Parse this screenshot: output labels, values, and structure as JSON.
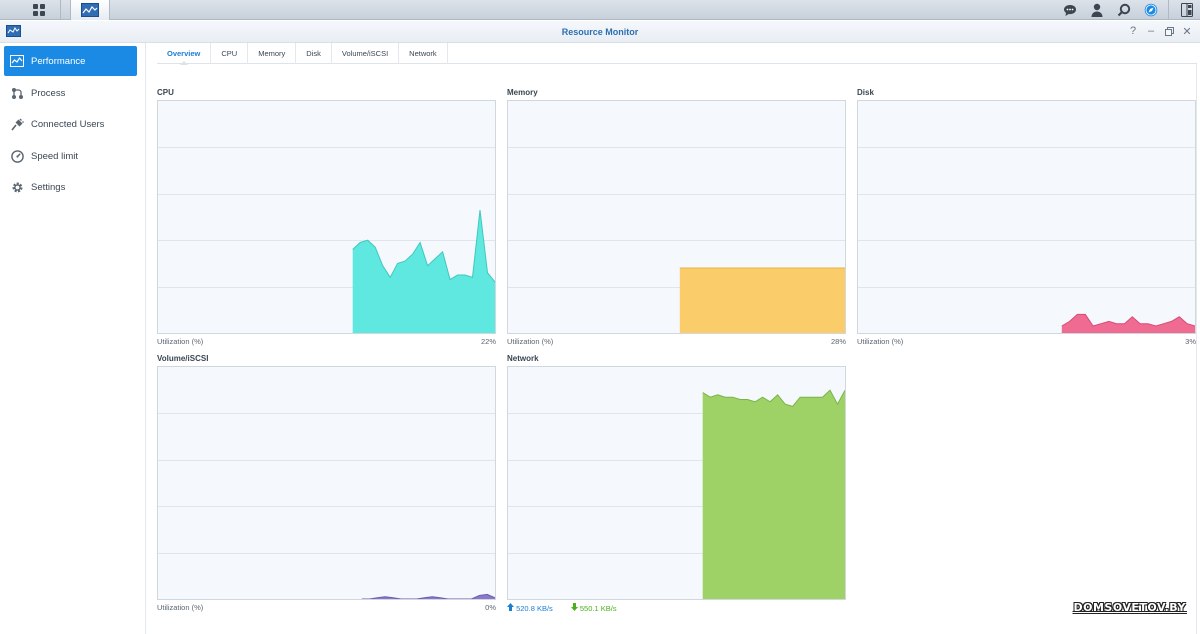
{
  "window": {
    "title": "Resource Monitor"
  },
  "taskbar": {
    "right_icons": [
      "chat-icon",
      "user-icon",
      "search-icon",
      "compass-icon",
      "widgets-icon"
    ]
  },
  "sidebar": {
    "items": [
      {
        "label": "Performance",
        "icon": "performance-icon",
        "active": true
      },
      {
        "label": "Process",
        "icon": "process-icon"
      },
      {
        "label": "Connected Users",
        "icon": "plug-icon"
      },
      {
        "label": "Speed limit",
        "icon": "speedometer-icon"
      },
      {
        "label": "Settings",
        "icon": "gear-icon"
      }
    ]
  },
  "tabs": [
    "Overview",
    "CPU",
    "Memory",
    "Disk",
    "Volume/iSCSI",
    "Network"
  ],
  "panels": {
    "cpu": {
      "title": "CPU",
      "foot_label": "Utilization (%)",
      "foot_value": "22%",
      "color": "#5ee8e0",
      "stroke": "#3fc7c0"
    },
    "memory": {
      "title": "Memory",
      "foot_label": "Utilization (%)",
      "foot_value": "28%",
      "color": "#fbcd6a",
      "stroke": "#e8b447"
    },
    "disk": {
      "title": "Disk",
      "foot_label": "Utilization (%)",
      "foot_value": "3%",
      "color": "#f06b92",
      "stroke": "#d94a76"
    },
    "volume": {
      "title": "Volume/iSCSI",
      "foot_label": "Utilization (%)",
      "foot_value": "0%",
      "color": "#8a78c9",
      "stroke": "#6d5bb5"
    },
    "network": {
      "title": "Network",
      "upload": "520.8 KB/s",
      "download": "550.1 KB/s",
      "color": "#9ed266",
      "stroke": "#7cb348"
    }
  },
  "chart_data": [
    {
      "type": "area",
      "title": "CPU",
      "ylabel": "Utilization (%)",
      "ylim": [
        0,
        100
      ],
      "values": [
        null,
        null,
        null,
        null,
        null,
        null,
        null,
        null,
        null,
        null,
        null,
        null,
        null,
        null,
        null,
        null,
        null,
        null,
        null,
        null,
        null,
        null,
        null,
        null,
        null,
        null,
        36,
        39,
        40,
        37,
        29,
        24,
        30,
        31,
        34,
        39,
        29,
        32,
        35,
        23,
        25,
        25,
        24,
        53,
        26,
        22
      ]
    },
    {
      "type": "area",
      "title": "Memory",
      "ylabel": "Utilization (%)",
      "ylim": [
        0,
        100
      ],
      "values": [
        null,
        null,
        null,
        null,
        null,
        null,
        null,
        null,
        null,
        null,
        null,
        null,
        null,
        null,
        null,
        null,
        null,
        null,
        null,
        null,
        null,
        null,
        null,
        null,
        null,
        null,
        28,
        28,
        28,
        28,
        28,
        28,
        28,
        28,
        28,
        28,
        28,
        28,
        28,
        28,
        28,
        28,
        28,
        28,
        28,
        28,
        28,
        28,
        28,
        28,
        28,
        28
      ]
    },
    {
      "type": "area",
      "title": "Disk",
      "ylabel": "Utilization (%)",
      "ylim": [
        0,
        100
      ],
      "values": [
        null,
        null,
        null,
        null,
        null,
        null,
        null,
        null,
        null,
        null,
        null,
        null,
        null,
        null,
        null,
        null,
        null,
        null,
        null,
        null,
        null,
        null,
        null,
        null,
        null,
        null,
        3,
        5,
        8,
        8,
        3,
        4,
        5,
        4,
        4,
        7,
        4,
        4,
        3,
        4,
        5,
        7,
        4,
        3
      ]
    },
    {
      "type": "area",
      "title": "Volume/iSCSI",
      "ylabel": "Utilization (%)",
      "ylim": [
        0,
        100
      ],
      "values": [
        null,
        null,
        null,
        null,
        null,
        null,
        null,
        null,
        null,
        null,
        null,
        null,
        null,
        null,
        null,
        null,
        null,
        null,
        null,
        null,
        null,
        null,
        null,
        null,
        null,
        null,
        0,
        0,
        0.5,
        1,
        0.5,
        0,
        0,
        0,
        0.5,
        1,
        0.5,
        0,
        0,
        0,
        0,
        1.5,
        2,
        0.5
      ]
    },
    {
      "type": "area",
      "title": "Network",
      "ylim": [
        0,
        100
      ],
      "values": [
        null,
        null,
        null,
        null,
        null,
        null,
        null,
        null,
        null,
        null,
        null,
        null,
        null,
        null,
        null,
        null,
        null,
        null,
        null,
        null,
        null,
        null,
        null,
        null,
        null,
        null,
        89,
        87,
        88,
        87,
        87,
        86,
        86,
        85,
        87,
        85,
        88,
        84,
        83,
        87,
        87,
        87,
        87,
        90,
        84,
        90
      ]
    }
  ],
  "watermark": "DOMSOVETOV.BY"
}
